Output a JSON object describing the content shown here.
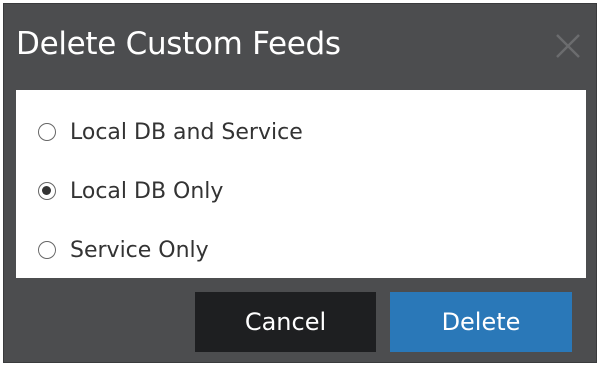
{
  "dialog": {
    "title": "Delete Custom Feeds",
    "close_icon": "close-icon",
    "options": [
      {
        "label": "Local DB and Service",
        "checked": false
      },
      {
        "label": "Local DB Only",
        "checked": true
      },
      {
        "label": "Service Only",
        "checked": false
      }
    ],
    "buttons": {
      "cancel_label": "Cancel",
      "delete_label": "Delete"
    },
    "colors": {
      "dialog_background": "#4c4d4f",
      "cancel_button": "#1e1f21",
      "delete_button": "#2a78b8"
    }
  }
}
